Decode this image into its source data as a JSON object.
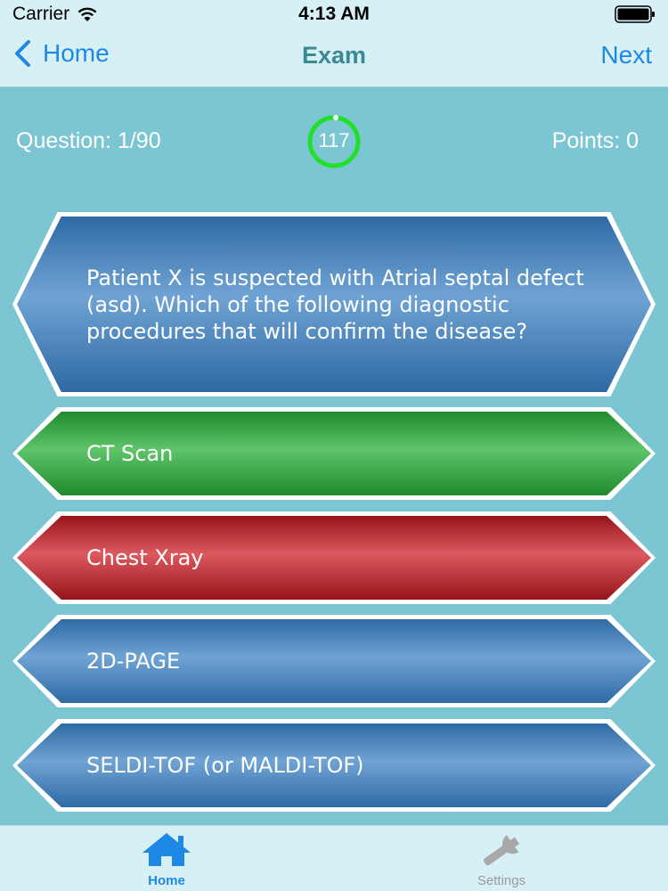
{
  "status_bar": {
    "carrier": "Carrier",
    "time": "4:13 AM"
  },
  "nav": {
    "back_label": "Home",
    "title": "Exam",
    "next_label": "Next"
  },
  "info": {
    "question_counter": "Question: 1/90",
    "timer": "117",
    "points": "Points: 0"
  },
  "question": {
    "text": "Patient X is suspected with Atrial septal defect (asd). Which of the following diagnostic procedures that will confirm the disease?"
  },
  "answers": [
    {
      "label": "CT Scan",
      "state": "correct"
    },
    {
      "label": "Chest Xray",
      "state": "incorrect"
    },
    {
      "label": "2D-PAGE",
      "state": "neutral"
    },
    {
      "label": "SELDI-TOF (or MALDI-TOF)",
      "state": "neutral"
    }
  ],
  "tabs": [
    {
      "label": "Home",
      "icon": "home-icon",
      "active": true
    },
    {
      "label": "Settings",
      "icon": "wrench-icon",
      "active": false
    }
  ],
  "colors": {
    "background": "#7cc6d3",
    "accent": "#1e88e5",
    "timer_ring": "#22e02a",
    "correct": "#2c9a36",
    "incorrect": "#b4232a",
    "neutral": "#3f7bb7"
  }
}
